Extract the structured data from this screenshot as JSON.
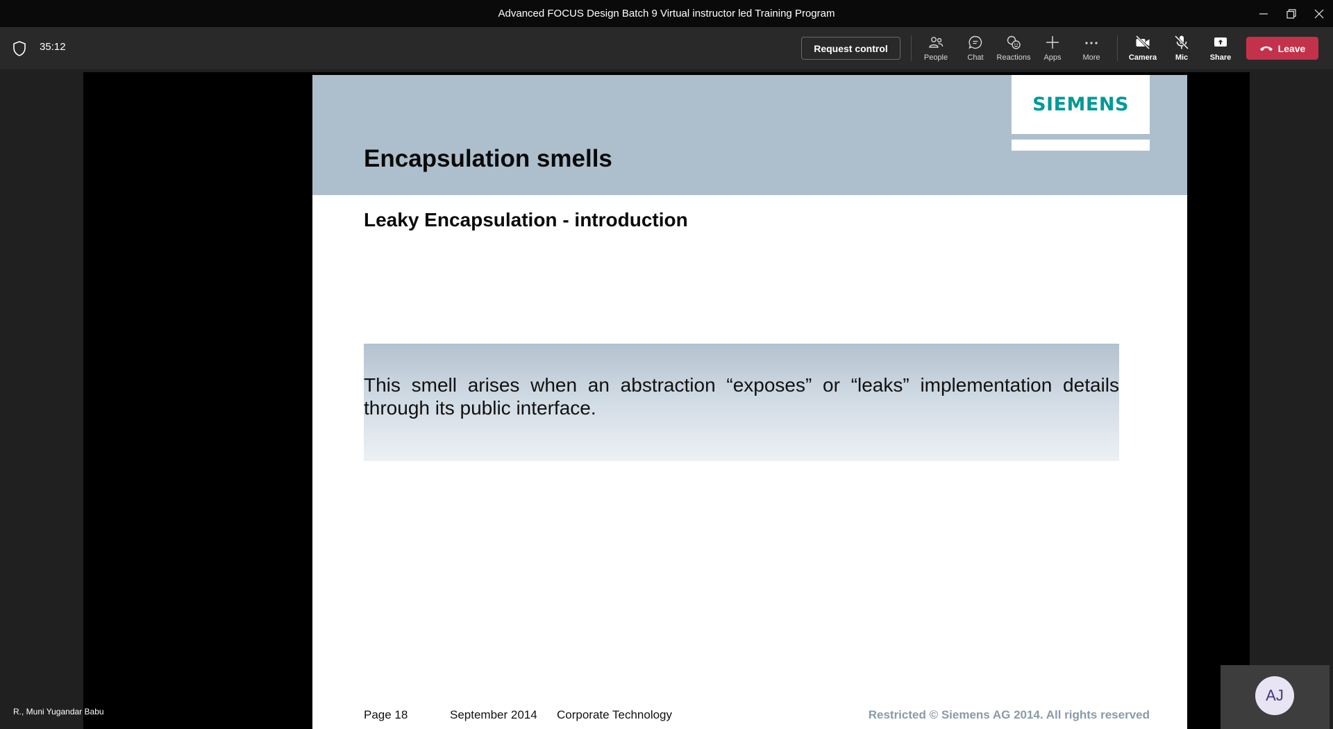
{
  "window": {
    "title": "Advanced FOCUS Design Batch 9 Virtual instructor led Training Program"
  },
  "toolbar": {
    "timer": "35:12",
    "request_control_label": "Request control",
    "buttons": {
      "people": "People",
      "chat": "Chat",
      "reactions": "Reactions",
      "apps": "Apps",
      "more": "More",
      "camera": "Camera",
      "mic": "Mic",
      "share": "Share"
    },
    "leave_label": "Leave",
    "leave_color": "#c4314b"
  },
  "slide": {
    "logo": "SIEMENS",
    "title": "Encapsulation smells",
    "subtitle": "Leaky Encapsulation - introduction",
    "body": "This smell arises when an abstraction “exposes” or “leaks” implementation details through its public interface.",
    "footer": {
      "page": "Page 18",
      "date": "September 2014",
      "department": "Corporate Technology",
      "copyright": "Restricted © Siemens AG 2014. All rights reserved"
    },
    "header_color": "#adbfcc",
    "logo_color": "#009999"
  },
  "participant": {
    "name": "R., Muni Yugandar Babu"
  },
  "self_view": {
    "initials": "AJ"
  }
}
